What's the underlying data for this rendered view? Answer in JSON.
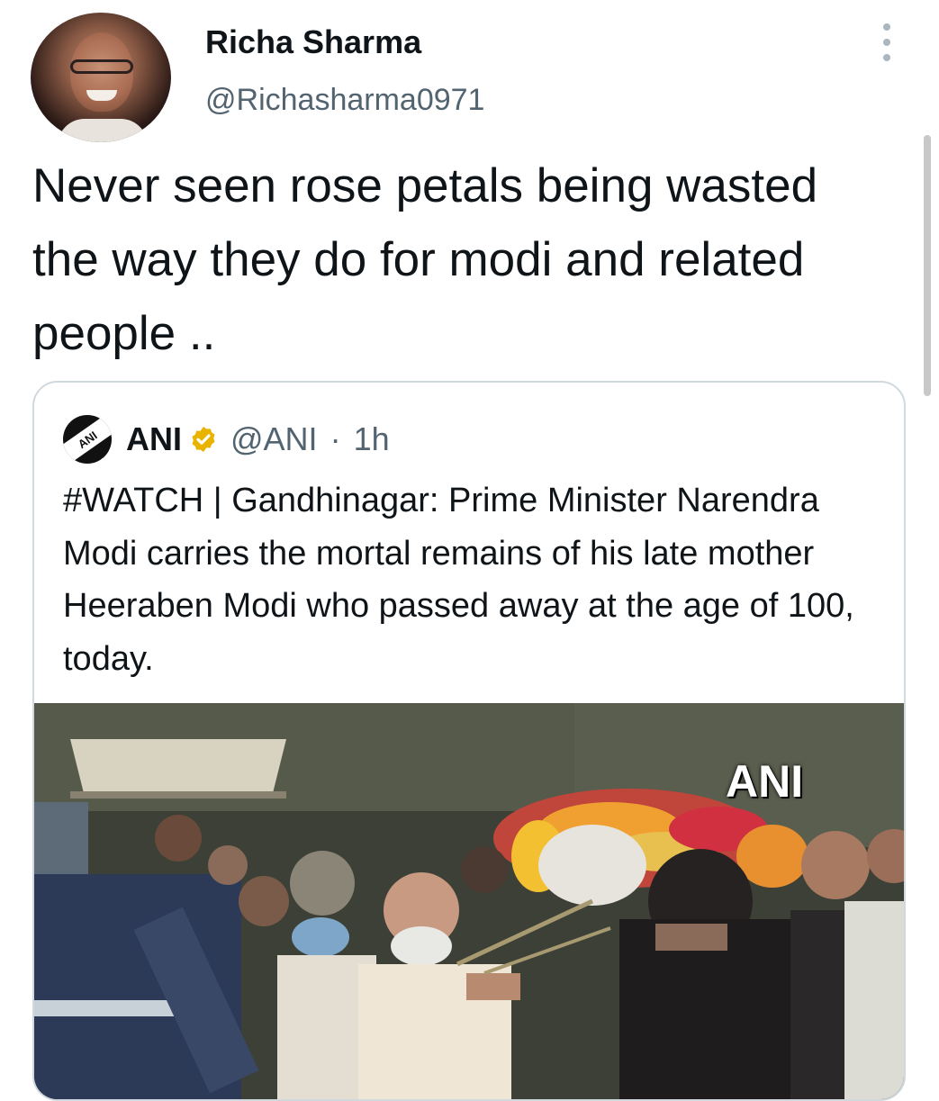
{
  "tweet": {
    "author_name": "Richa Sharma",
    "author_handle": "@Richasharma0971",
    "text": "Never seen rose petals being wasted the way they do for modi and related people .."
  },
  "quoted_tweet": {
    "author_name": "ANI",
    "author_handle": "@ANI",
    "timestamp": "1h",
    "separator": "·",
    "logo_text": "ANI",
    "verified_color": "#e8b400",
    "text": "#WATCH | Gandhinagar: Prime Minister Narendra Modi carries the mortal remains of his late mother Heeraben Modi who passed away at the age of 100, today.",
    "media": {
      "watermark": "ANI"
    }
  },
  "icons": {
    "more": "more-vertical-icon",
    "verified": "verified-badge-icon"
  },
  "colors": {
    "text_primary": "#0f1419",
    "text_secondary": "#536471",
    "border": "#cfd9de"
  }
}
